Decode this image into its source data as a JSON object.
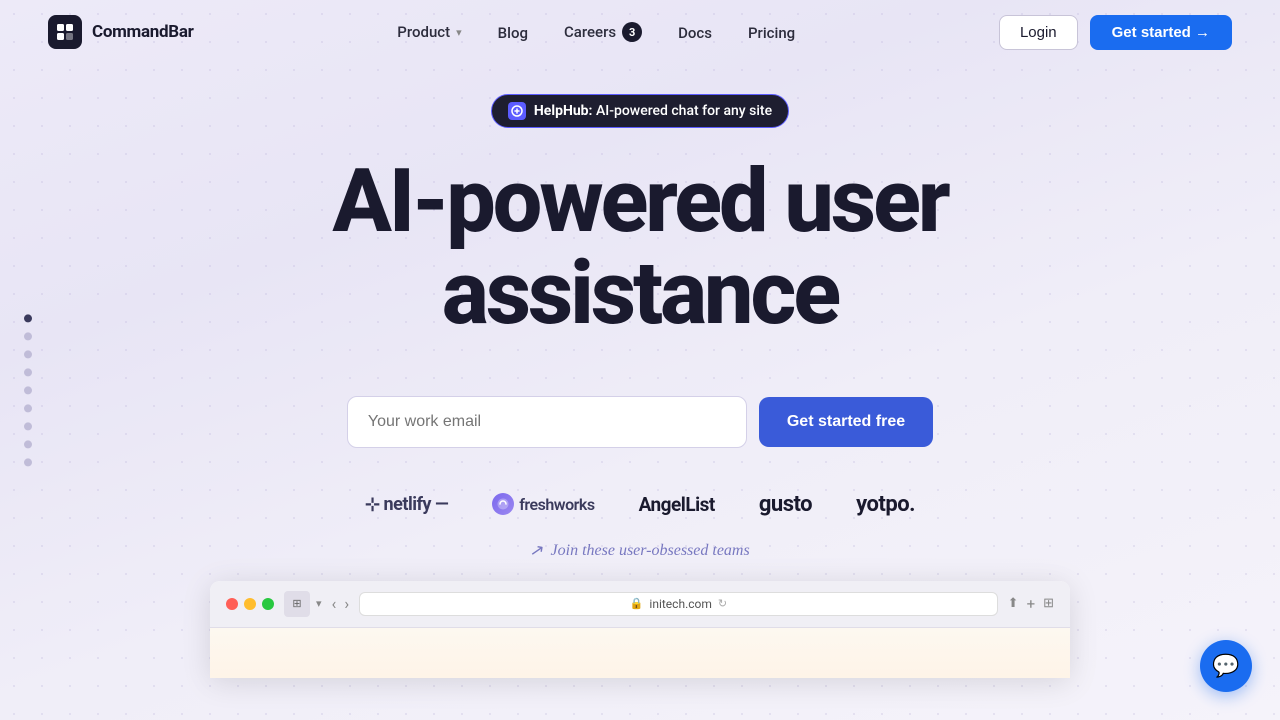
{
  "nav": {
    "logo_text": "CommandBar",
    "links": [
      {
        "id": "product",
        "label": "Product",
        "has_dropdown": true
      },
      {
        "id": "blog",
        "label": "Blog"
      },
      {
        "id": "careers",
        "label": "Careers",
        "badge": "3"
      },
      {
        "id": "docs",
        "label": "Docs"
      },
      {
        "id": "pricing",
        "label": "Pricing"
      }
    ],
    "login_label": "Login",
    "get_started_label": "Get started →"
  },
  "helphub_badge": {
    "label": "HelpHub:",
    "description": "AI-powered chat for any site"
  },
  "hero": {
    "line1": "AI-powered user",
    "line2": "assistance"
  },
  "email_form": {
    "placeholder": "Your work email",
    "cta_label": "Get started free"
  },
  "logos": [
    {
      "id": "netlify",
      "text": "—netlify—"
    },
    {
      "id": "freshworks",
      "text": "freshworks"
    },
    {
      "id": "angellist",
      "text": "AngelList"
    },
    {
      "id": "gusto",
      "text": "gusto"
    },
    {
      "id": "yotpo",
      "text": "yotpo."
    }
  ],
  "join_text": "Join these user-obsessed teams",
  "browser": {
    "url": "initech.com"
  },
  "side_nav": {
    "dots": [
      {
        "active": true
      },
      {
        "active": false
      },
      {
        "active": false
      },
      {
        "active": false
      },
      {
        "active": false
      },
      {
        "active": false
      },
      {
        "active": false
      },
      {
        "active": false
      },
      {
        "active": false
      }
    ]
  }
}
